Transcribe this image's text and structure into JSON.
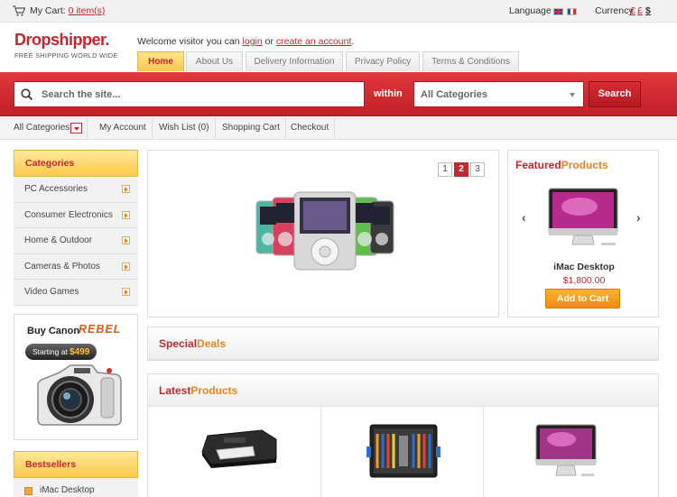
{
  "topbar": {
    "cart_label": "My Cart:",
    "cart_items": "0 item(s)",
    "language_label": "Language",
    "currency_label": "Currency",
    "currencies": [
      "€",
      "£",
      "$"
    ]
  },
  "header": {
    "logo": "Dropshipper.",
    "tagline": "FREE SHIPPING WORLD WIDE",
    "welcome_prefix": "Welcome visitor you can",
    "login": "login",
    "or": "or",
    "create_account": "create an account",
    "welcome_suffix": ".",
    "tabs": [
      "Home",
      "About Us",
      "Delivery Information",
      "Privacy Policy",
      "Terms & Conditions"
    ]
  },
  "search": {
    "placeholder": "Search the site...",
    "within": "within",
    "category": "All Categories",
    "button": "Search"
  },
  "nav": {
    "items": [
      "All Categories",
      "My Account",
      "Wish List (0)",
      "Shopping Cart",
      "Checkout"
    ]
  },
  "sidebar": {
    "categories_title": "Categories",
    "categories": [
      "PC Accessories",
      "Consumer Electronics",
      "Home & Outdoor",
      "Cameras & Photos",
      "Video Games"
    ],
    "banner": {
      "buy": "Buy Canon",
      "model": "REBEL",
      "starting": "Starting at",
      "price": "$499"
    },
    "bestsellers_title": "Bestsellers",
    "bestsellers": [
      "iMac Desktop"
    ]
  },
  "slider": {
    "pages": [
      "1",
      "2",
      "3"
    ],
    "active": 2
  },
  "featured": {
    "title_a": "Featured",
    "title_b": "Products",
    "name": "iMac Desktop",
    "price": "$1,800.00",
    "add_to_cart": "Add to Cart"
  },
  "special": {
    "title_a": "Special",
    "title_b": "Deals"
  },
  "latest": {
    "title_a": "Latest",
    "title_b": "Products"
  },
  "colors": {
    "brand_red": "#c4262e",
    "accent_orange": "#e7831e",
    "tab_yellow": "#f9c94a"
  }
}
